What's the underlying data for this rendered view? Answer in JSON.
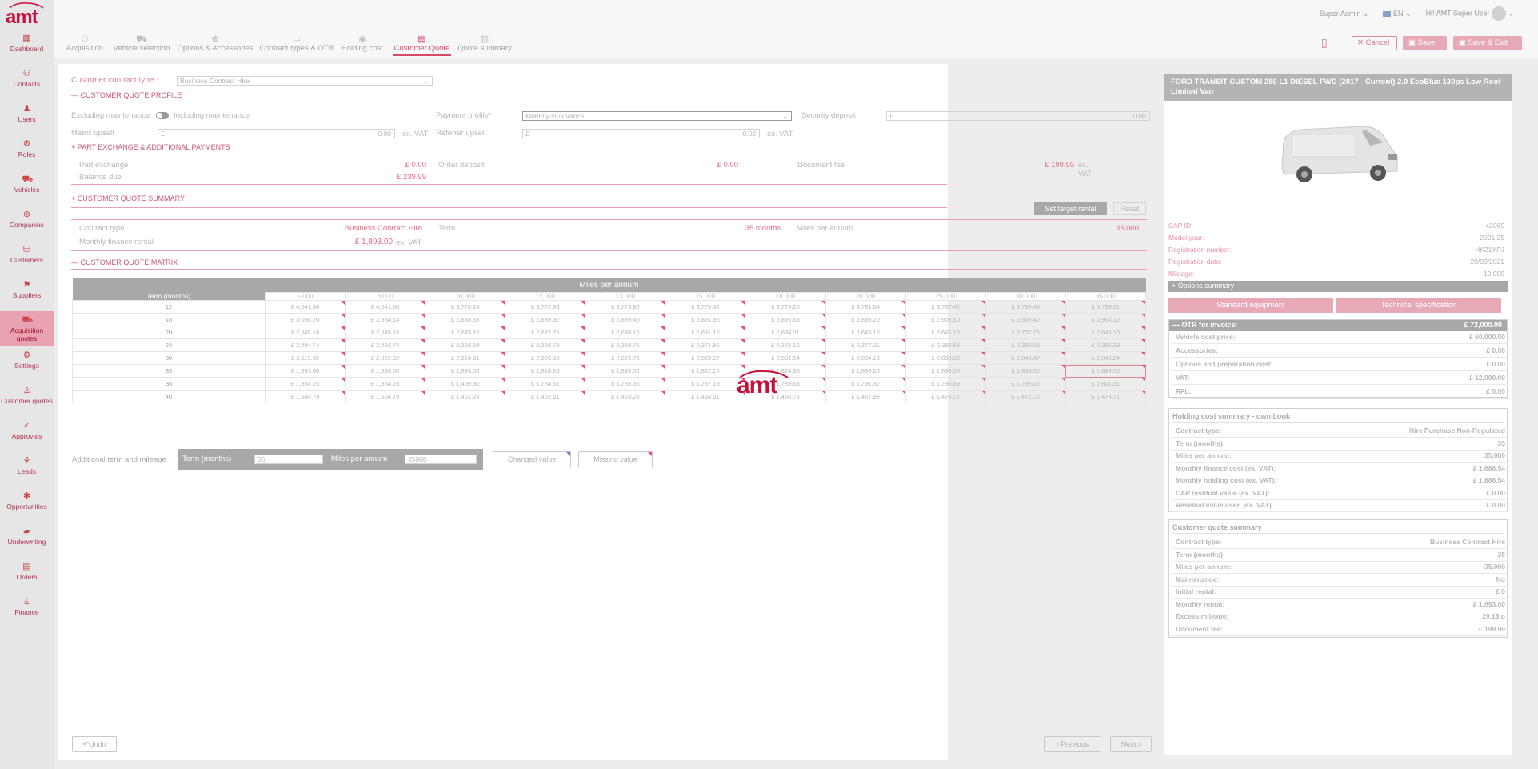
{
  "app": {
    "brand": "amt"
  },
  "topbar": {
    "role": "Super Admin",
    "lang": "EN",
    "greeting": "Hi! AMT Super User"
  },
  "sidebar": {
    "items": [
      {
        "label": "Dashboard",
        "icon": "dashboard-icon"
      },
      {
        "label": "Contacts",
        "icon": "contacts-icon"
      },
      {
        "label": "Users",
        "icon": "user-icon"
      },
      {
        "label": "Roles",
        "icon": "roles-icon"
      },
      {
        "label": "Vehicles",
        "icon": "car-icon"
      },
      {
        "label": "Companies",
        "icon": "companies-icon"
      },
      {
        "label": "Customers",
        "icon": "customers-icon"
      },
      {
        "label": "Suppliers",
        "icon": "suppliers-icon"
      },
      {
        "label": "Acquisition quotes",
        "icon": "acquisition-icon"
      },
      {
        "label": "Settings",
        "icon": "gear-icon"
      },
      {
        "label": "Customer quotes",
        "icon": "customer-quotes-icon"
      },
      {
        "label": "Approvals",
        "icon": "check-icon"
      },
      {
        "label": "Leads",
        "icon": "leads-icon"
      },
      {
        "label": "Opportunities",
        "icon": "opportunities-icon"
      },
      {
        "label": "Underwriting",
        "icon": "underwriting-icon"
      },
      {
        "label": "Orders",
        "icon": "orders-icon"
      },
      {
        "label": "Finance",
        "icon": "pound-icon"
      }
    ]
  },
  "steps": [
    "Acquisition",
    "Vehicle selection",
    "Options & Accessories",
    "Contract types & OTR",
    "Holding cost",
    "Customer Quote",
    "Quote summary"
  ],
  "actions": {
    "cancel": "Cancel",
    "save": "Save",
    "save_exit": "Save & Exit"
  },
  "form": {
    "contract_type_label": "Customer contract type :",
    "contract_type_value": "Business Contract Hire",
    "profile_title": "CUSTOMER QUOTE PROFILE",
    "excl_maint": "Excluding maintenance",
    "incl_maint": "Including maintenance",
    "payment_profile_label": "Payment profile*",
    "payment_profile_value": "Monthly in advance",
    "security_deposit_label": "Security deposit",
    "security_deposit_currency": "£",
    "security_deposit_value": "0.00",
    "matrix_upsell_label": "Matrix upsell",
    "matrix_upsell_currency": "£",
    "matrix_upsell_value": "0.00",
    "ex_vat": "ex. VAT",
    "referrer_upsell_label": "Referrer upsell",
    "referrer_upsell_currency": "£",
    "referrer_upsell_value": "0.00"
  },
  "part_exchange": {
    "title": "PART EXCHANGE & ADDITIONAL PAYMENTS",
    "part_exchange_label": "Part exchange",
    "part_exchange_value": "£ 0.00",
    "order_deposit_label": "Order deposit",
    "order_deposit_value": "£ 0.00",
    "document_fee_label": "Document fee",
    "document_fee_value": "£ 199.99",
    "ex_vat": "ex. VAT",
    "balance_due_label": "Balance due",
    "balance_due_value": "£ 239.99"
  },
  "summary": {
    "title": "CUSTOMER QUOTE SUMMARY",
    "set_target": "Set target rental",
    "reset": "Reset",
    "contract_type_label": "Contract type",
    "contract_type_value": "Business Contract Hire",
    "term_label": "Term",
    "term_value": "35 months",
    "miles_label": "Miles per annum",
    "miles_value": "35,000",
    "monthly_label": "Monthly finance rental",
    "monthly_value": "£ 1,893.00",
    "ex_vat": "ex. VAT"
  },
  "matrix": {
    "title": "CUSTOMER QUOTE MATRIX",
    "header": "Miles per annum",
    "term_header": "Term (months)",
    "miles": [
      "5,000",
      "8,000",
      "10,000",
      "12,000",
      "13,000",
      "15,000",
      "18,000",
      "20,000",
      "25,000",
      "30,000",
      "35,000"
    ],
    "rows": [
      {
        "term": "12",
        "values": [
          "£ 4,041.66",
          "£ 4,041.66",
          "£ 3,770.24",
          "£ 3,772.99",
          "£ 3,773.86",
          "£ 3,775.42",
          "£ 3,779.25",
          "£ 3,781.64",
          "£ 3,787.42",
          "£ 3,793.43",
          "£ 3,799.51"
        ]
      },
      {
        "term": "18",
        "values": [
          "£ 3,056.20",
          "£ 2,884.14",
          "£ 2,888.33",
          "£ 2,889.92",
          "£ 2,889.40",
          "£ 2,891.95",
          "£ 2,895.69",
          "£ 2,898.20",
          "£ 2,903.50",
          "£ 2,909.42",
          "£ 2,914.12"
        ]
      },
      {
        "term": "20",
        "values": [
          "£ 2,645.16",
          "£ 2,645.16",
          "£ 2,645.16",
          "£ 2,687.76",
          "£ 2,689.16",
          "£ 2,691.16",
          "£ 2,694.01",
          "£ 2,645.16",
          "£ 2,645.16",
          "£ 2,707.76",
          "£ 2,645.16"
        ]
      },
      {
        "term": "24",
        "values": [
          "£ 2,494.74",
          "£ 2,494.74",
          "£ 2,366.59",
          "£ 2,366.79",
          "£ 2,369.76",
          "£ 2,371.95",
          "£ 2,375.12",
          "£ 2,377.21",
          "£ 2,382.68",
          "£ 2,388.03",
          "£ 2,393.39"
        ]
      },
      {
        "term": "30",
        "values": [
          "£ 2,119.30",
          "£ 2,022.02",
          "£ 2,024.01",
          "£ 2,026.50",
          "£ 2,026.79",
          "£ 2,028.97",
          "£ 2,031.54",
          "£ 2,034.13",
          "£ 2,039.09",
          "£ 2,043.47",
          "£ 2,046.24"
        ]
      },
      {
        "term": "35",
        "values": [
          "£ 1,893.00",
          "£ 1,893.00",
          "£ 1,893.00",
          "£ 1,818.85",
          "£ 1,893.00",
          "£ 1,822.25",
          "£ 1,824.99",
          "£ 1,893.00",
          "£ 1,893.00",
          "£ 1,834.56",
          "£ 1,893.00"
        ]
      },
      {
        "term": "36",
        "values": [
          "£ 1,954.25",
          "£ 1,954.25",
          "£ 1,409.90",
          "£ 1,784.51",
          "£ 1,785.35",
          "£ 1,787.19",
          "£ 1,789.68",
          "£ 1,791.32",
          "£ 1,795.69",
          "£ 1,799.02",
          "£ 1,801.51"
        ]
      },
      {
        "term": "40",
        "values": [
          "£ 1,504.79",
          "£ 1,504.79",
          "£ 1,461.24",
          "£ 1,462.61",
          "£ 1,463.24",
          "£ 1,464.61",
          "£ 1,466.73",
          "£ 1,467.98",
          "£ 1,470.72",
          "£ 1,472.72",
          "£ 1,474.71"
        ]
      }
    ]
  },
  "additional": {
    "label": "Additional term and mileage",
    "term_label": "Term (months)",
    "term_value": "35",
    "miles_label": "Miles per annum",
    "miles_value": "35000",
    "changed": "Changed value",
    "missing": "Missing value"
  },
  "bottom": {
    "undo": "Undo",
    "previous": "Previous",
    "next": "Next"
  },
  "vehicle": {
    "title": "FORD TRANSIT CUSTOM 280 L1 DIESEL FWD (2017 - Current) 2.0 EcoBlue 130ps Low Roof Limited Van",
    "details": [
      {
        "k": "CAP ID:",
        "v": "42060"
      },
      {
        "k": "Model year:",
        "v": "2021.25"
      },
      {
        "k": "Registration number:",
        "v": "HK21YPJ"
      },
      {
        "k": "Registration date:",
        "v": "29/03/2021"
      },
      {
        "k": "Mileage:",
        "v": "10,000"
      }
    ],
    "options_summary": "Options summary",
    "standard_equipment": "Standard equipment",
    "technical_spec": "Technical specification",
    "otr_label": "OTR for invoice:",
    "otr_value": "£ 72,000.00",
    "otr_lines": [
      {
        "k": "Vehicle cost price:",
        "v": "£ 60,000.00"
      },
      {
        "k": "Accessories:",
        "v": "£ 0.00"
      },
      {
        "k": "Options and preparation cost:",
        "v": "£ 0.00"
      },
      {
        "k": "VAT:",
        "v": "£ 12,000.00"
      },
      {
        "k": "RFL:",
        "v": "£ 0.00"
      }
    ],
    "holding_title": "Holding cost summary - own book",
    "holding_lines": [
      {
        "k": "Contract type:",
        "v": "Hire Purchase Non-Regulated"
      },
      {
        "k": "Term (months):",
        "v": "35"
      },
      {
        "k": "Miles per annum:",
        "v": "35,000"
      },
      {
        "k": "Monthly finance cost (ex. VAT):",
        "v": "£ 1,686.54"
      },
      {
        "k": "Monthly holding cost (ex. VAT):",
        "v": "£ 1,686.54"
      },
      {
        "k": "CAP residual value (ex. VAT):",
        "v": "£ 0.00"
      },
      {
        "k": "Residual value used (ex. VAT):",
        "v": "£ 0.00"
      }
    ],
    "cq_title": "Customer quote summary",
    "cq_lines": [
      {
        "k": "Contract type:",
        "v": "Business Contract Hire"
      },
      {
        "k": "Term (months):",
        "v": "35"
      },
      {
        "k": "Miles per annum:",
        "v": "35,000"
      },
      {
        "k": "Maintenance:",
        "v": "No"
      },
      {
        "k": "Initial rental:",
        "v": "£ 0"
      },
      {
        "k": "Monthly rental:",
        "v": "£ 1,893.00"
      },
      {
        "k": "Excess mileage:",
        "v": "29.18 p"
      },
      {
        "k": "Document fee:",
        "v": "£ 199.99"
      }
    ]
  },
  "colors": {
    "accent": "#d74a65",
    "sidebar_bg": "#e6e6e6",
    "header_grey": "#a8a8a8"
  }
}
